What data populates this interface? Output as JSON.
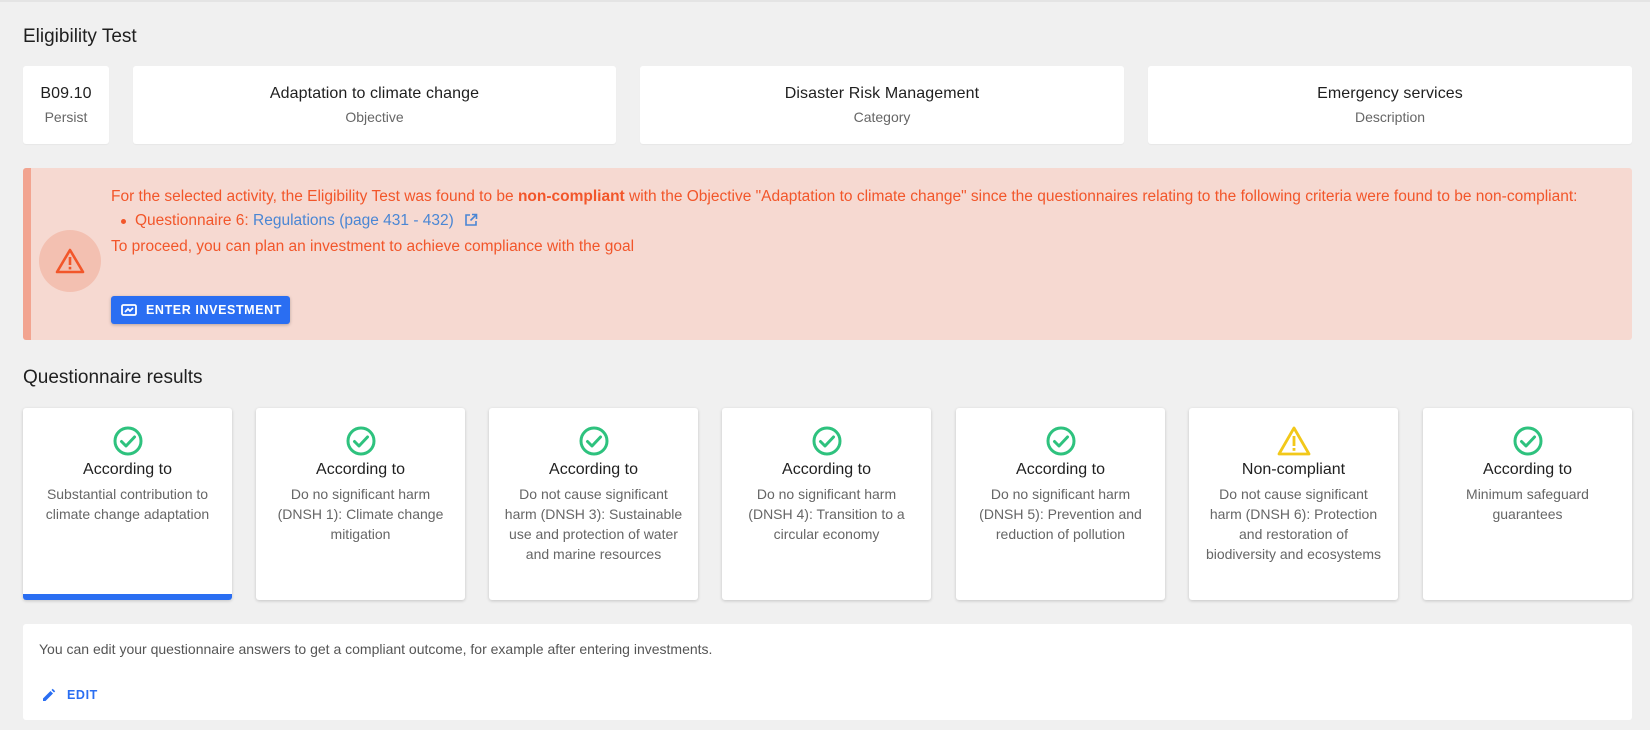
{
  "page": {
    "title": "Eligibility Test",
    "questionnaire_title": "Questionnaire results"
  },
  "info_cards": [
    {
      "main": "B09.10",
      "sub": "Persist"
    },
    {
      "main": "Adaptation to climate change",
      "sub": "Objective"
    },
    {
      "main": "Disaster Risk Management",
      "sub": "Category"
    },
    {
      "main": "Emergency services",
      "sub": "Description"
    }
  ],
  "alert": {
    "text_before": "For the selected activity, the Eligibility Test was found to be ",
    "text_bold": "non-compliant",
    "text_after": " with the Objective \"Adaptation to climate change\" since the questionnaires relating to the following criteria were found to be non-compliant:",
    "item_prefix": "Questionnaire 6: ",
    "item_link": "Regulations (page 431 - 432)",
    "proceed_text": "To proceed, you can plan an investment to achieve compliance with the goal",
    "button_label": "ENTER INVESTMENT",
    "colors": {
      "text": "#f2562a",
      "background": "#f6d9d1",
      "link": "#4a86d4"
    }
  },
  "questionnaires": [
    {
      "status": "According to",
      "description": "Substantial contribution to climate change adaptation",
      "icon": "check-circle-icon",
      "active": true
    },
    {
      "status": "According to",
      "description": "Do no significant harm (DNSH 1): Climate change mitigation",
      "icon": "check-circle-icon",
      "active": false
    },
    {
      "status": "According to",
      "description": "Do not cause significant harm (DNSH 3): Sustainable use and protection of water and marine resources",
      "icon": "check-circle-icon",
      "active": false
    },
    {
      "status": "According to",
      "description": "Do no significant harm (DNSH 4): Transition to a circular economy",
      "icon": "check-circle-icon",
      "active": false
    },
    {
      "status": "According to",
      "description": "Do no significant harm (DNSH 5): Prevention and reduction of pollution",
      "icon": "check-circle-icon",
      "active": false
    },
    {
      "status": "Non-compliant",
      "description": "Do not cause significant harm (DNSH 6): Protection and restoration of biodiversity and ecosystems",
      "icon": "warning-triangle-icon",
      "active": false
    },
    {
      "status": "According to",
      "description": "Minimum safeguard guarantees",
      "icon": "check-circle-icon",
      "active": false
    }
  ],
  "edit_panel": {
    "message": "You can edit your questionnaire answers to get a compliant outcome, for example after entering investments.",
    "button_label": "EDIT"
  },
  "colors": {
    "accent": "#2a6ef2",
    "success": "#2ec27e",
    "warning": "#f2c81a"
  }
}
